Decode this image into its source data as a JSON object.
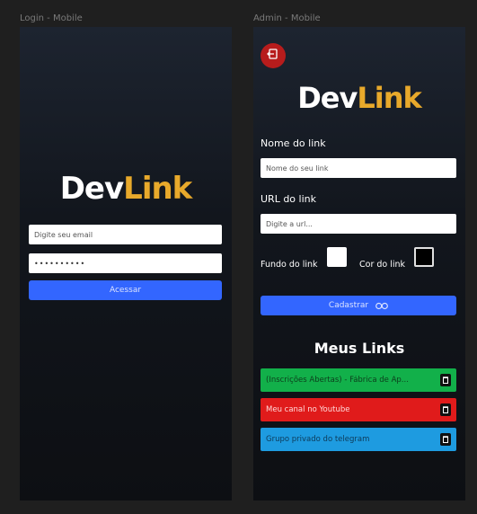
{
  "frames": {
    "login_label": "Login - Mobile",
    "admin_label": "Admin - Mobile"
  },
  "brand": {
    "part1": "Dev",
    "part2": "Link"
  },
  "login": {
    "email_placeholder": "Digite seu email",
    "password_value": "••••••••••",
    "submit_label": "Acessar"
  },
  "admin": {
    "link_name_label": "Nome do link",
    "link_name_placeholder": "Nome do seu link",
    "url_label": "URL do link",
    "url_placeholder": "Digite a url...",
    "bg_label": "Fundo do link",
    "text_color_label": "Cor do link",
    "submit_label": "Cadastrar",
    "links_title": "Meus Links",
    "links": [
      {
        "text": "(Inscrições Abertas) - Fábrica de Ap...",
        "bg": "#12b04a",
        "color": "#0d3d1c"
      },
      {
        "text": "Meu canal no Youtube",
        "bg": "#e01b1b",
        "color": "#ffd9d9"
      },
      {
        "text": "Grupo privado do telegram",
        "bg": "#1e9be0",
        "color": "#0d3a58"
      }
    ]
  },
  "colors": {
    "accent": "#e8a92b",
    "primary_button": "#3366ff",
    "logout": "#b71c1c"
  }
}
